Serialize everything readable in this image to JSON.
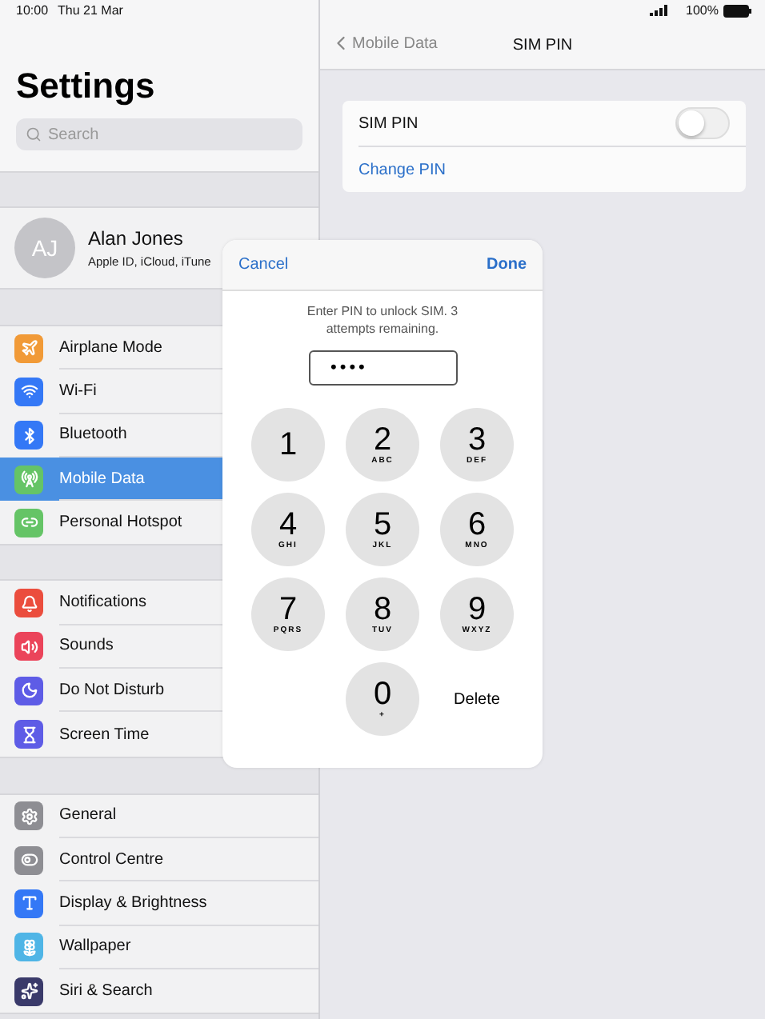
{
  "status_bar": {
    "time": "10:00",
    "date": "Thu 21 Mar",
    "battery": "100%"
  },
  "sidebar": {
    "title": "Settings",
    "search": {
      "placeholder": "Search"
    },
    "profile": {
      "initials": "AJ",
      "name": "Alan Jones",
      "subtitle": "Apple ID, iCloud, iTune"
    },
    "groups": [
      [
        {
          "label": "Airplane Mode",
          "color": "#f19a37",
          "selected": false
        },
        {
          "label": "Wi-Fi",
          "color": "#3478f6",
          "selected": false
        },
        {
          "label": "Bluetooth",
          "color": "#3478f6",
          "selected": false
        },
        {
          "label": "Mobile Data",
          "color": "#65c466",
          "selected": true
        },
        {
          "label": "Personal Hotspot",
          "color": "#65c466",
          "selected": false
        }
      ],
      [
        {
          "label": "Notifications",
          "color": "#eb4d3d",
          "selected": false
        },
        {
          "label": "Sounds",
          "color": "#eb445a",
          "selected": false
        },
        {
          "label": "Do Not Disturb",
          "color": "#5e5ce6",
          "selected": false
        },
        {
          "label": "Screen Time",
          "color": "#5e5ce6",
          "selected": false
        }
      ],
      [
        {
          "label": "General",
          "color": "#8e8e93",
          "selected": false
        },
        {
          "label": "Control Centre",
          "color": "#8e8e93",
          "selected": false
        },
        {
          "label": "Display & Brightness",
          "color": "#3478f6",
          "selected": false
        },
        {
          "label": "Wallpaper",
          "color": "#4fb5e6",
          "selected": false
        },
        {
          "label": "Siri & Search",
          "color": "#3a3a6a",
          "selected": false
        }
      ]
    ]
  },
  "detail": {
    "back": "Mobile Data",
    "title": "SIM PIN",
    "rows": [
      {
        "kind": "toggle",
        "label": "SIM PIN",
        "on": false
      },
      {
        "kind": "link",
        "label": "Change PIN"
      }
    ]
  },
  "dialog": {
    "cancel": "Cancel",
    "done": "Done",
    "message": "Enter PIN to unlock SIM. 3 attempts remaining.",
    "value": "••••",
    "keys": [
      {
        "kind": "digit",
        "digit": "1"
      },
      {
        "kind": "digit",
        "digit": "2",
        "letters": "ABC"
      },
      {
        "kind": "digit",
        "digit": "3",
        "letters": "DEF"
      },
      {
        "kind": "digit",
        "digit": "4",
        "letters": "GHI"
      },
      {
        "kind": "digit",
        "digit": "5",
        "letters": "JKL"
      },
      {
        "kind": "digit",
        "digit": "6",
        "letters": "MNO"
      },
      {
        "kind": "digit",
        "digit": "7",
        "letters": "PQRS"
      },
      {
        "kind": "digit",
        "digit": "8",
        "letters": "TUV"
      },
      {
        "kind": "digit",
        "digit": "9",
        "letters": "WXYZ"
      },
      {
        "kind": "blank"
      },
      {
        "kind": "digit",
        "digit": "0",
        "letters": "+"
      },
      {
        "kind": "action",
        "label": "Delete"
      }
    ]
  }
}
